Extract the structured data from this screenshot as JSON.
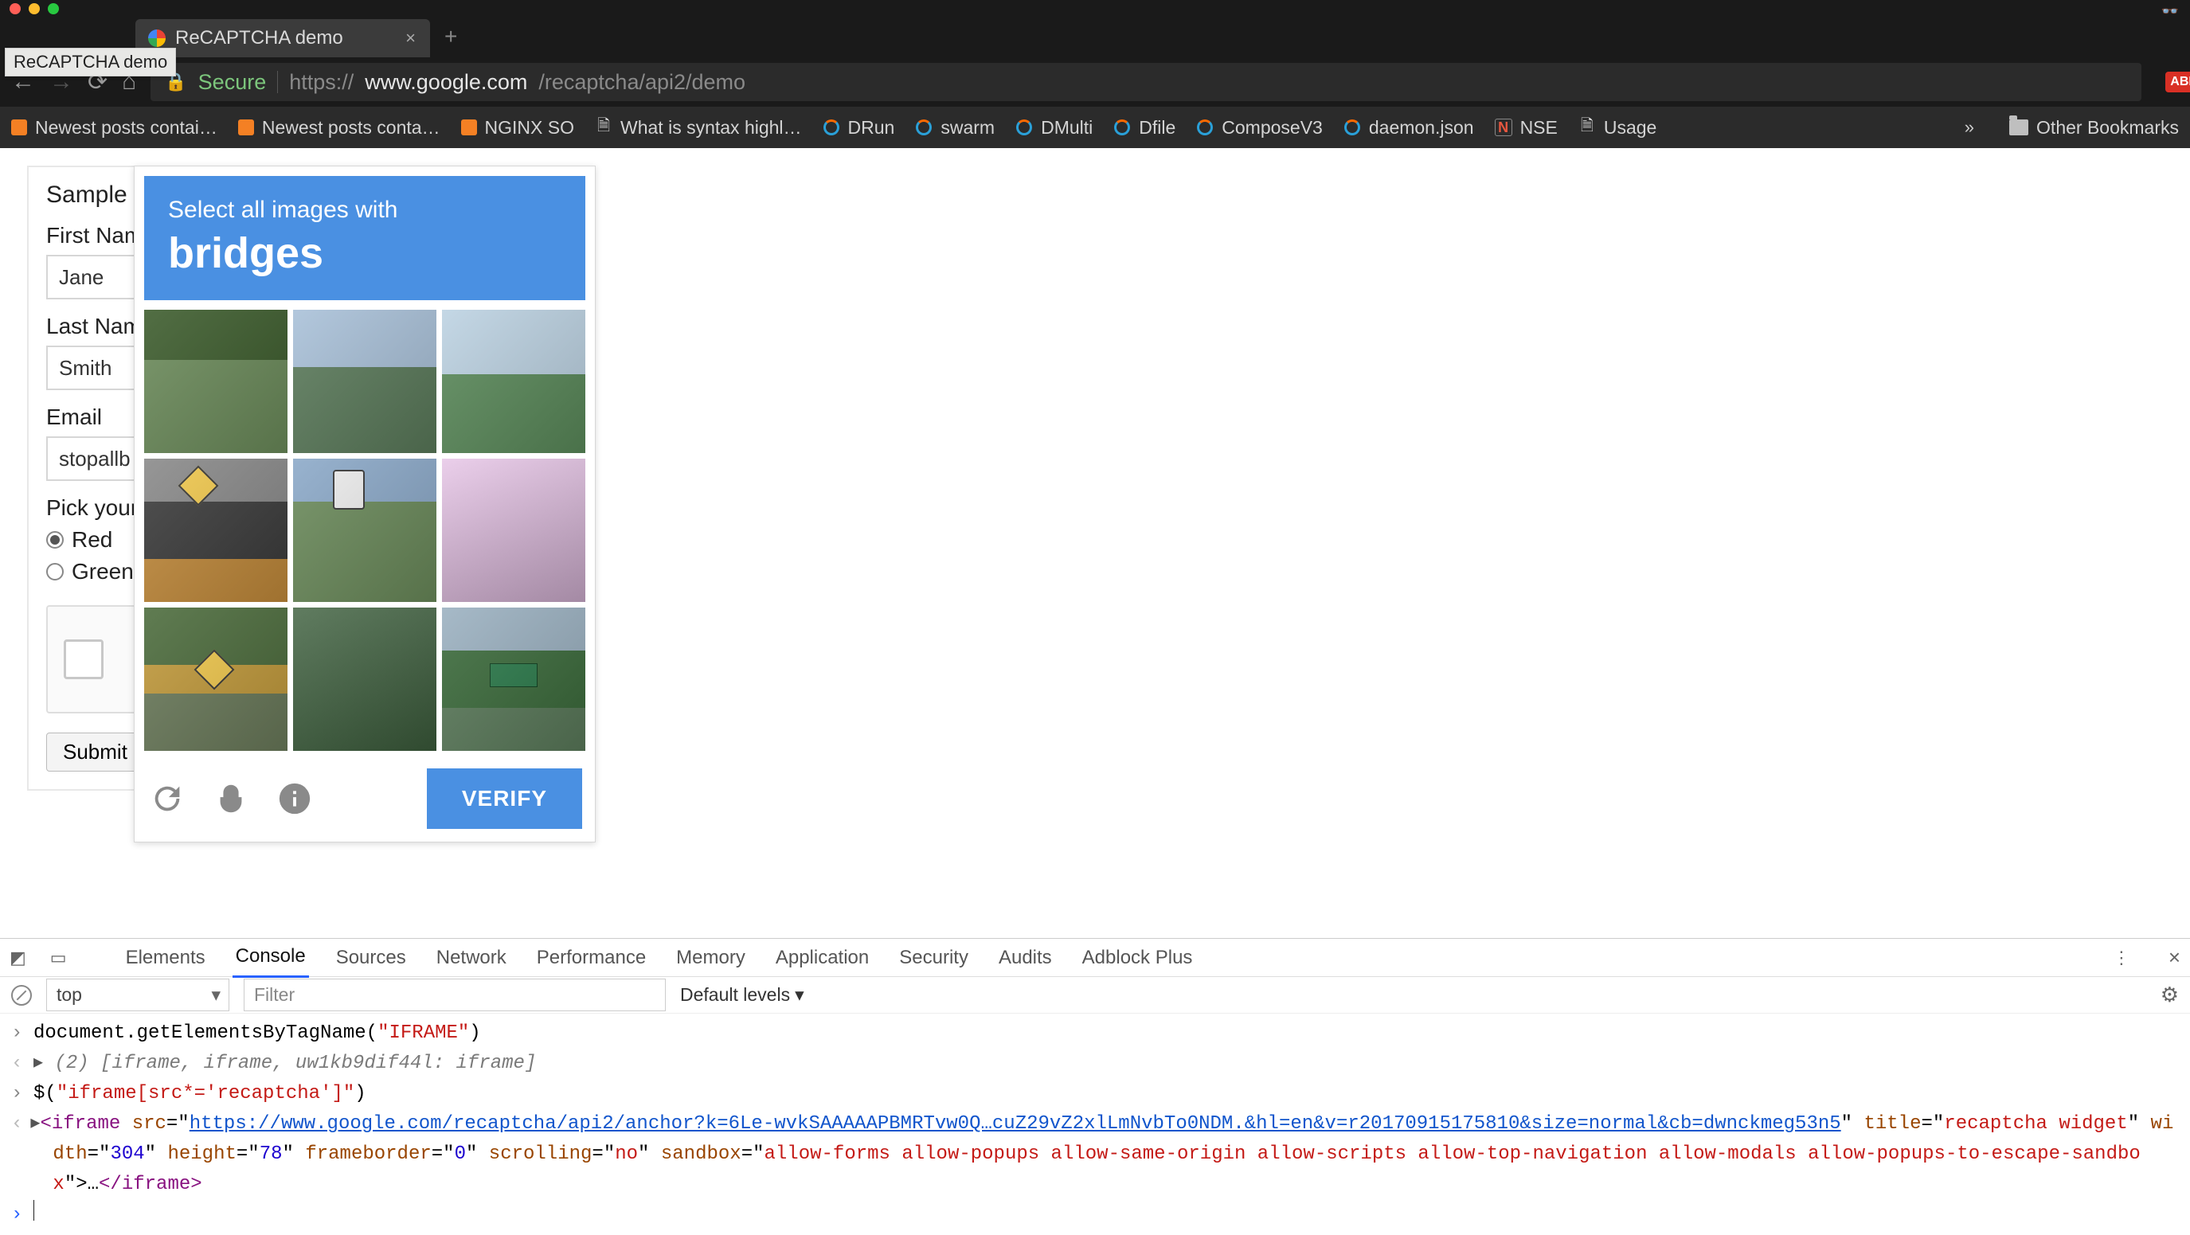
{
  "browser": {
    "hover_tooltip": "ReCAPTCHA demo",
    "tab_title": "ReCAPTCHA demo",
    "secure_label": "Secure",
    "url_proto": "https://",
    "url_host": "www.google.com",
    "url_path": "/recaptcha/api2/demo",
    "ext_badge": "ABP"
  },
  "bookmarks": {
    "items": [
      "Newest posts contai…",
      "Newest posts conta…",
      "NGINX SO",
      "What is syntax highl…",
      "DRun",
      "swarm",
      "DMulti",
      "Dfile",
      "ComposeV3",
      "daemon.json",
      "NSE",
      "Usage"
    ],
    "other": "Other Bookmarks"
  },
  "form": {
    "title": "Sample",
    "first_label": "First Name",
    "first_value": "Jane",
    "last_label": "Last Name",
    "last_value": "Smith",
    "email_label": "Email",
    "email_value": "stopallb",
    "pick_label": "Pick your",
    "radio_red": "Red",
    "radio_green": "Green",
    "submit": "Submit"
  },
  "captcha": {
    "line1": "Select all images with",
    "line2": "bridges",
    "verify": "VERIFY"
  },
  "devtools": {
    "tabs": [
      "Elements",
      "Console",
      "Sources",
      "Network",
      "Performance",
      "Memory",
      "Application",
      "Security",
      "Audits",
      "Adblock Plus"
    ],
    "active_tab": "Console",
    "context": "top",
    "filter_placeholder": "Filter",
    "levels": "Default levels",
    "line1": "document.getElementsByTagName(\"IFRAME\")",
    "line2_prefix": "(2) ",
    "line2_body": "[iframe, iframe, uw1kb9dif44l: iframe]",
    "line3": "$(\"iframe[src*='recaptcha']\")",
    "iframe_src": "https://www.google.com/recaptcha/api2/anchor?k=6Le-wvkSAAAAAPBMRTvw0Q…cuZ29vZ2xlLmNvbTo0NDM.&hl=en&v=r20170915175810&size=normal&cb=dwnckmeg53n5",
    "iframe_title": "recaptcha widget",
    "iframe_width": "304",
    "iframe_height": "78",
    "iframe_frameborder": "0",
    "iframe_scrolling": "no",
    "iframe_sandbox": "allow-forms allow-popups allow-same-origin allow-scripts allow-top-navigation allow-modals allow-popups-to-escape-sandbox"
  }
}
